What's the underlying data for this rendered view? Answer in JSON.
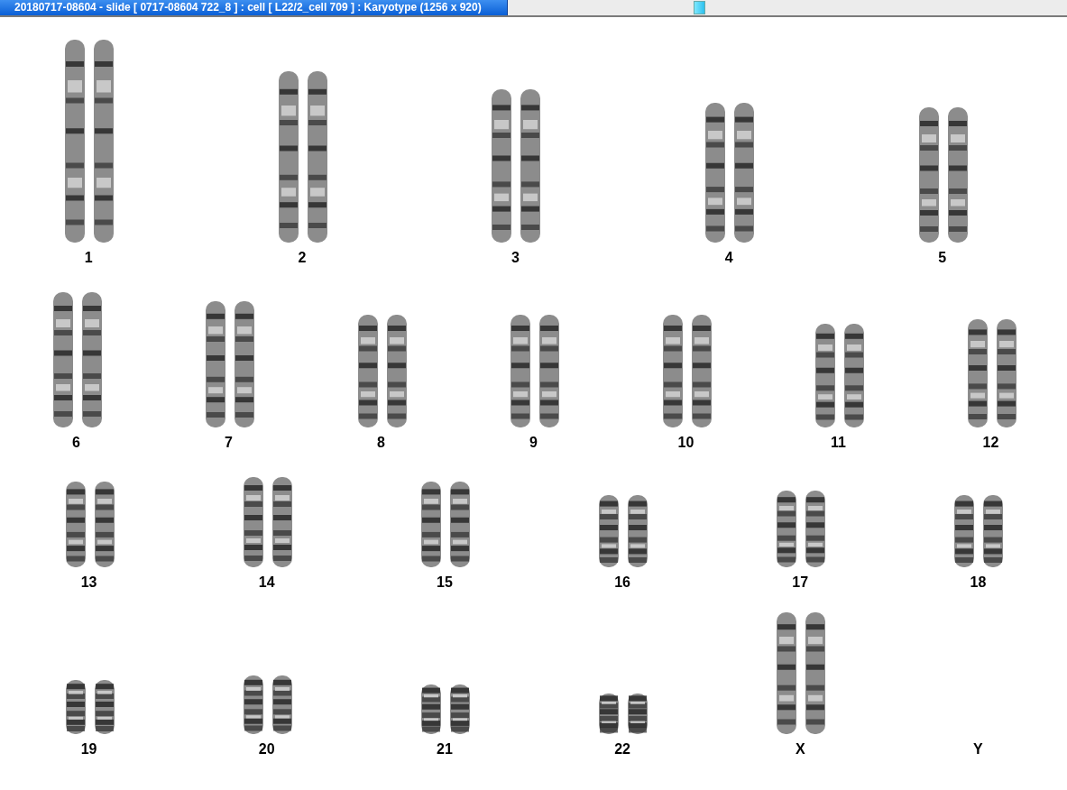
{
  "window": {
    "title": "20180717-08604 - slide [ 0717-08604 722_8 ] : cell [ L22/2_cell 709 ] : Karyotype  (1256 x 920)"
  },
  "karyotype_rows": [
    {
      "groups": [
        {
          "label": "1",
          "kind": "pair"
        },
        {
          "label": "2",
          "kind": "pair"
        },
        {
          "label": "3",
          "kind": "pair"
        },
        {
          "label": "4",
          "kind": "pair"
        },
        {
          "label": "5",
          "kind": "pair"
        }
      ]
    },
    {
      "groups": [
        {
          "label": "6",
          "kind": "pair"
        },
        {
          "label": "7",
          "kind": "pair"
        },
        {
          "label": "8",
          "kind": "pair"
        },
        {
          "label": "9",
          "kind": "pair"
        },
        {
          "label": "10",
          "kind": "pair"
        },
        {
          "label": "11",
          "kind": "pair"
        },
        {
          "label": "12",
          "kind": "pair"
        }
      ]
    },
    {
      "groups": [
        {
          "label": "13",
          "kind": "pair"
        },
        {
          "label": "14",
          "kind": "pair"
        },
        {
          "label": "15",
          "kind": "pair"
        },
        {
          "label": "16",
          "kind": "pair"
        },
        {
          "label": "17",
          "kind": "pair"
        },
        {
          "label": "18",
          "kind": "pair"
        }
      ]
    },
    {
      "groups": [
        {
          "label": "19",
          "kind": "pair"
        },
        {
          "label": "20",
          "kind": "pair"
        },
        {
          "label": "21",
          "kind": "pair"
        },
        {
          "label": "22",
          "kind": "pair"
        },
        {
          "label": "X",
          "kind": "pair"
        },
        {
          "label": "Y",
          "kind": "empty"
        }
      ]
    }
  ]
}
